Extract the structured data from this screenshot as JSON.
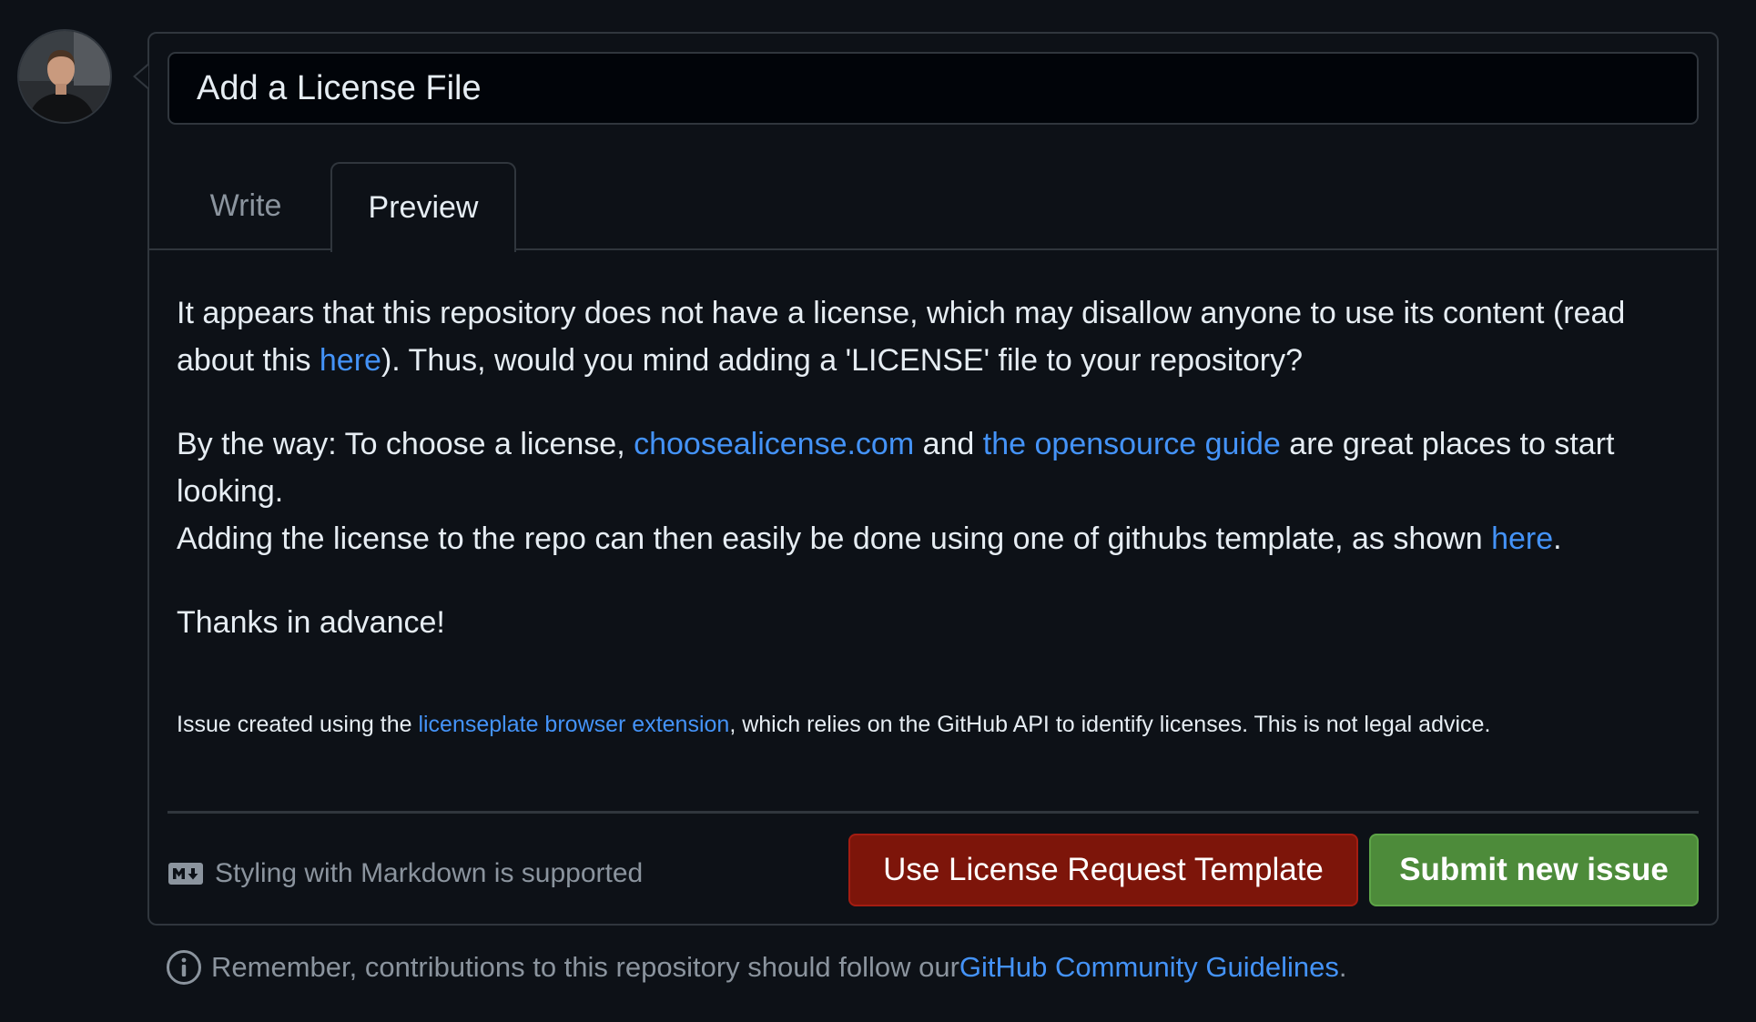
{
  "issue": {
    "title_value": "Add a License File"
  },
  "tabs": [
    {
      "label": "Write"
    },
    {
      "label": "Preview"
    }
  ],
  "preview": {
    "p1_text": "It appears that this repository does not have a license, which may disallow anyone to use its content (read about this ",
    "p1_link": "here",
    "p1_tail": "). Thus, would you mind adding a 'LICENSE' file to your repository?",
    "p2_text": "By the way: To choose a license, ",
    "p2_link1": "choosealicense.com",
    "p2_and": " and ",
    "p2_link2": "the opensource guide",
    "p2_tail": " are great places to start looking.",
    "p2_line2": "Adding the license to the repo can then easily be done using one of githubs template, as shown ",
    "p2_link3": "here",
    "p2_end": ".",
    "p3_text": "Thanks in advance!",
    "footnote_text": "Issue created using the ",
    "footnote_link": "licenseplate browser extension",
    "footnote_tail": ", which relies on the GitHub API to identify licenses. This is not legal advice."
  },
  "footer": {
    "markdown_hint": "Styling with Markdown is supported",
    "template_button": "Use License Request Template",
    "submit_button": "Submit new issue",
    "guidelines_text": "Remember, contributions to this repository should follow our ",
    "guidelines_link": "GitHub Community Guidelines",
    "guidelines_end": "."
  },
  "icons": {
    "avatar": "user-avatar",
    "markdown": "markdown-icon",
    "info": "info-icon"
  },
  "colors": {
    "background": "#0d1117",
    "link": "#4493f8",
    "template_button": "#7d150a",
    "submit_button": "#4d8b3a"
  }
}
